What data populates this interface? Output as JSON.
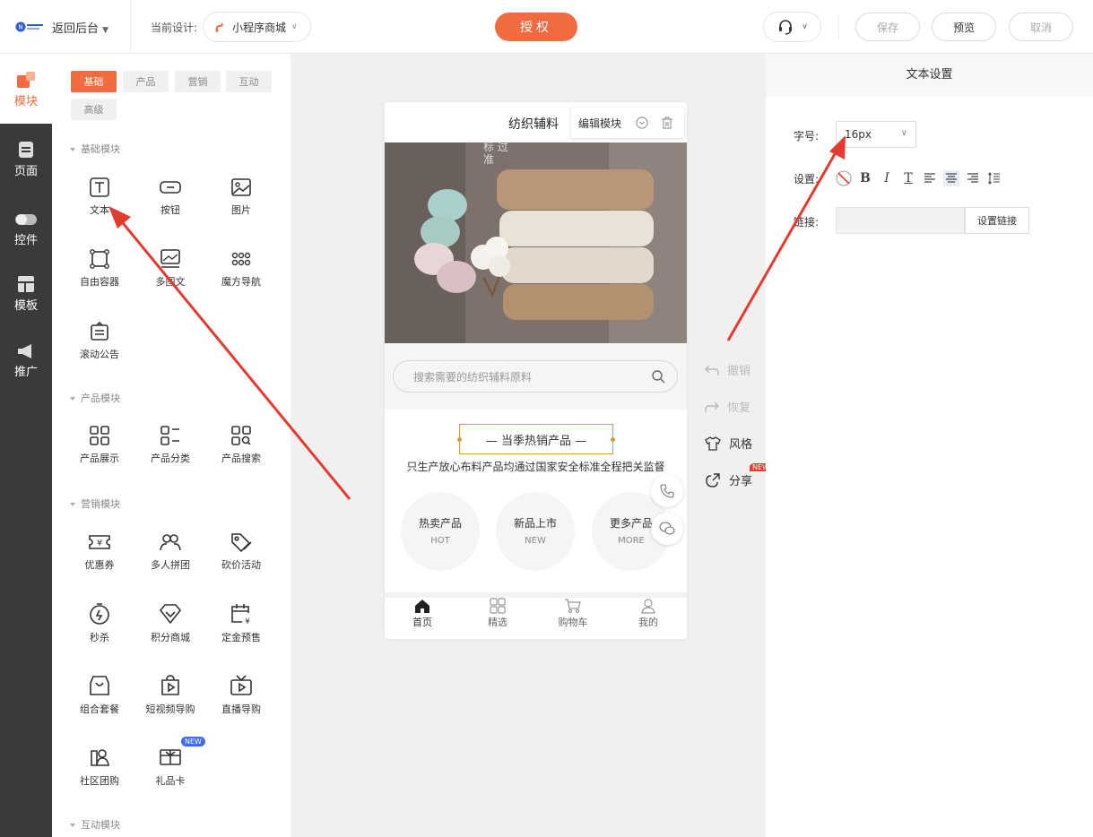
{
  "topbar": {
    "back_label": "返回后台",
    "current_design_label": "当前设计:",
    "current_design_value": "小程序商城",
    "auth_label": "授权",
    "save_label": "保存",
    "preview_label": "预览",
    "cancel_label": "取消"
  },
  "leftnav": {
    "items": [
      {
        "label": "模块"
      },
      {
        "label": "页面"
      },
      {
        "label": "控件"
      },
      {
        "label": "模板"
      },
      {
        "label": "推广"
      }
    ]
  },
  "panel": {
    "tabs": [
      "基础",
      "产品",
      "营销",
      "互动",
      "高级"
    ],
    "sections": {
      "basic": "基础模块",
      "product": "产品模块",
      "marketing": "营销模块",
      "interactive": "互动模块"
    },
    "modules": {
      "text": "文本",
      "button": "按钮",
      "image": "图片",
      "free_container": "自由容器",
      "multi_text": "多图文",
      "magic_nav": "魔方导航",
      "notice": "滚动公告",
      "product_show": "产品展示",
      "product_category": "产品分类",
      "product_search": "产品搜索",
      "coupon": "优惠券",
      "group_buy": "多人拼团",
      "bargain": "砍价活动",
      "seckill": "秒杀",
      "points_mall": "积分商城",
      "deposit_presale": "定金预售",
      "combo": "组合套餐",
      "short_video": "短视频导购",
      "live": "直播导购",
      "community_group": "社区团购",
      "gift_card": "礼品卡"
    },
    "new_badge": "NEW"
  },
  "phone": {
    "title": "纺织辅料",
    "edit_module": "编辑模块",
    "banner_text": "标 过 准",
    "search_placeholder": "搜索需要的纺织辅料原料",
    "hot_title": "— 当季热销产品 —",
    "hot_subtitle": "只生产放心布料产品均通过国家安全标准全程把关监督",
    "circles": [
      {
        "main": "热卖产品",
        "sub": "HOT"
      },
      {
        "main": "新品上市",
        "sub": "NEW"
      },
      {
        "main": "更多产品",
        "sub": "MORE"
      }
    ],
    "tabs": [
      "首页",
      "精选",
      "购物车",
      "我的"
    ]
  },
  "righttools": {
    "undo": "撤销",
    "redo": "恢复",
    "style": "风格",
    "share": "分享",
    "share_badge": "NEW"
  },
  "rpanel": {
    "title": "文本设置",
    "font_size_label": "字号:",
    "font_size_value": "16px",
    "settings_label": "设置:",
    "link_label": "链接:",
    "set_link_label": "设置链接"
  },
  "colors": {
    "accent": "#f26a3f",
    "sidebar": "#3a3a3a",
    "annotation_arrow": "#e53a2f"
  }
}
